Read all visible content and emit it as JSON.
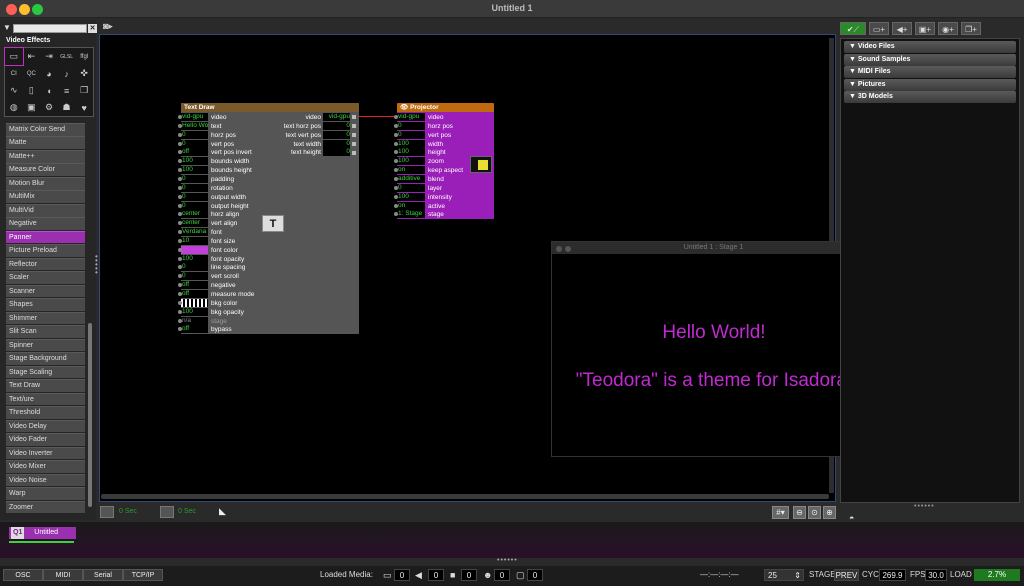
{
  "window": {
    "title": "Untitled 1"
  },
  "left_panel": {
    "title": "Video Effects",
    "icons": [
      "frame-icon",
      "arrow-in-icon",
      "arrow-out-icon",
      "glsl-icon",
      "ffgl-icon",
      "ci-icon",
      "qc-icon",
      "palette-icon",
      "speaker-icon",
      "gamepad-icon",
      "wave-icon",
      "phone-icon",
      "mouse-icon",
      "sliders-icon",
      "pages-icon",
      "antenna-icon",
      "chip-icon",
      "gear-icon",
      "person-icon",
      "heart-icon"
    ],
    "icon_text": {
      "ci": "CI",
      "qc": "QC",
      "glsl": "GLSL",
      "ffgl": "ffgl"
    },
    "actors": [
      "Matrix Color Send",
      "Matte",
      "Matte++",
      "Measure Color",
      "Motion Blur",
      "MultiMix",
      "MultiVid",
      "Negative",
      "Panner",
      "Picture Preload",
      "Reflector",
      "Scaler",
      "Scanner",
      "Shapes",
      "Shimmer",
      "Slit Scan",
      "Spinner",
      "Stage Background",
      "Stage Scaling",
      "Text Draw",
      "Text/ure",
      "Threshold",
      "Video Delay",
      "Video Fader",
      "Video Inverter",
      "Video Mixer",
      "Video Noise",
      "Warp",
      "Zoomer"
    ],
    "selected_actor": "Panner"
  },
  "text_draw": {
    "title": "Text Draw",
    "inputs": [
      {
        "value": "vid-gpu",
        "label": "video"
      },
      {
        "value": "Hello Wo",
        "label": "text"
      },
      {
        "value": "0",
        "label": "horz pos"
      },
      {
        "value": "0",
        "label": "vert pos"
      },
      {
        "value": "off",
        "label": "vert pos invert"
      },
      {
        "value": "100",
        "label": "bounds width"
      },
      {
        "value": "100",
        "label": "bounds height"
      },
      {
        "value": "0",
        "label": "padding"
      },
      {
        "value": "0",
        "label": "rotation"
      },
      {
        "value": "0",
        "label": "output width"
      },
      {
        "value": "0",
        "label": "output height"
      },
      {
        "value": "center",
        "label": "horz align"
      },
      {
        "value": "center",
        "label": "vert align"
      },
      {
        "value": "Verdana",
        "label": "font"
      },
      {
        "value": "10",
        "label": "font size"
      },
      {
        "value": "",
        "label": "font color"
      },
      {
        "value": "100",
        "label": "font opacity"
      },
      {
        "value": "0",
        "label": "line spacing"
      },
      {
        "value": "0",
        "label": "vert scroll"
      },
      {
        "value": "off",
        "label": "negative"
      },
      {
        "value": "off",
        "label": "measure mode"
      },
      {
        "value": "",
        "label": "bkg color"
      },
      {
        "value": "100",
        "label": "bkg opacity"
      },
      {
        "value": "n/a",
        "label": "stage"
      },
      {
        "value": "off",
        "label": "bypass"
      }
    ],
    "outputs": [
      {
        "label": "video",
        "value": "vid-gpu"
      },
      {
        "label": "text horz pos",
        "value": "0"
      },
      {
        "label": "text vert pos",
        "value": "0"
      },
      {
        "label": "text width",
        "value": "0"
      },
      {
        "label": "text height",
        "value": "0"
      }
    ],
    "font_color": "#c040d8"
  },
  "projector": {
    "title": "Projector",
    "inputs": [
      {
        "value": "vid-gpu",
        "label": "video"
      },
      {
        "value": "0",
        "label": "horz pos"
      },
      {
        "value": "0",
        "label": "vert pos"
      },
      {
        "value": "100",
        "label": "width"
      },
      {
        "value": "100",
        "label": "height"
      },
      {
        "value": "100",
        "label": "zoom"
      },
      {
        "value": "on",
        "label": "keep aspect"
      },
      {
        "value": "additive",
        "label": "blend"
      },
      {
        "value": "0",
        "label": "layer"
      },
      {
        "value": "100",
        "label": "intensity"
      },
      {
        "value": "on",
        "label": "active"
      },
      {
        "value": "1: Stage",
        "label": "stage"
      }
    ]
  },
  "stage_window": {
    "title": "Untitled 1 : Stage 1",
    "line1": "Hello World!",
    "line2": "\"Teodora\" is a theme for Isadora.",
    "text_color": "#c02ad0"
  },
  "media_panel": {
    "sections": [
      "Video Files",
      "Sound Samples",
      "MIDI Files",
      "Pictures",
      "3D Models"
    ]
  },
  "controls": {
    "sec_left": "0 Sec",
    "sec_right": "0 Sec",
    "hash": "#"
  },
  "scene": {
    "number": "Q1",
    "name": "Untitled"
  },
  "status": {
    "buttons": [
      "OSC",
      "MIDI",
      "Serial",
      "TCP/IP"
    ],
    "loaded_media_label": "Loaded Media:",
    "media_counts": [
      "0",
      "0",
      "0",
      "0",
      "0"
    ],
    "timecode": "—:—:—:—",
    "fps_target": "25",
    "stage_label": "STAGE",
    "prev_label": "PREV",
    "cyc_label": "CYC",
    "cyc_value": "269.9",
    "fps_label": "FPS",
    "fps_value": "30.0",
    "load_label": "LOAD",
    "load_value": "2.7%"
  }
}
